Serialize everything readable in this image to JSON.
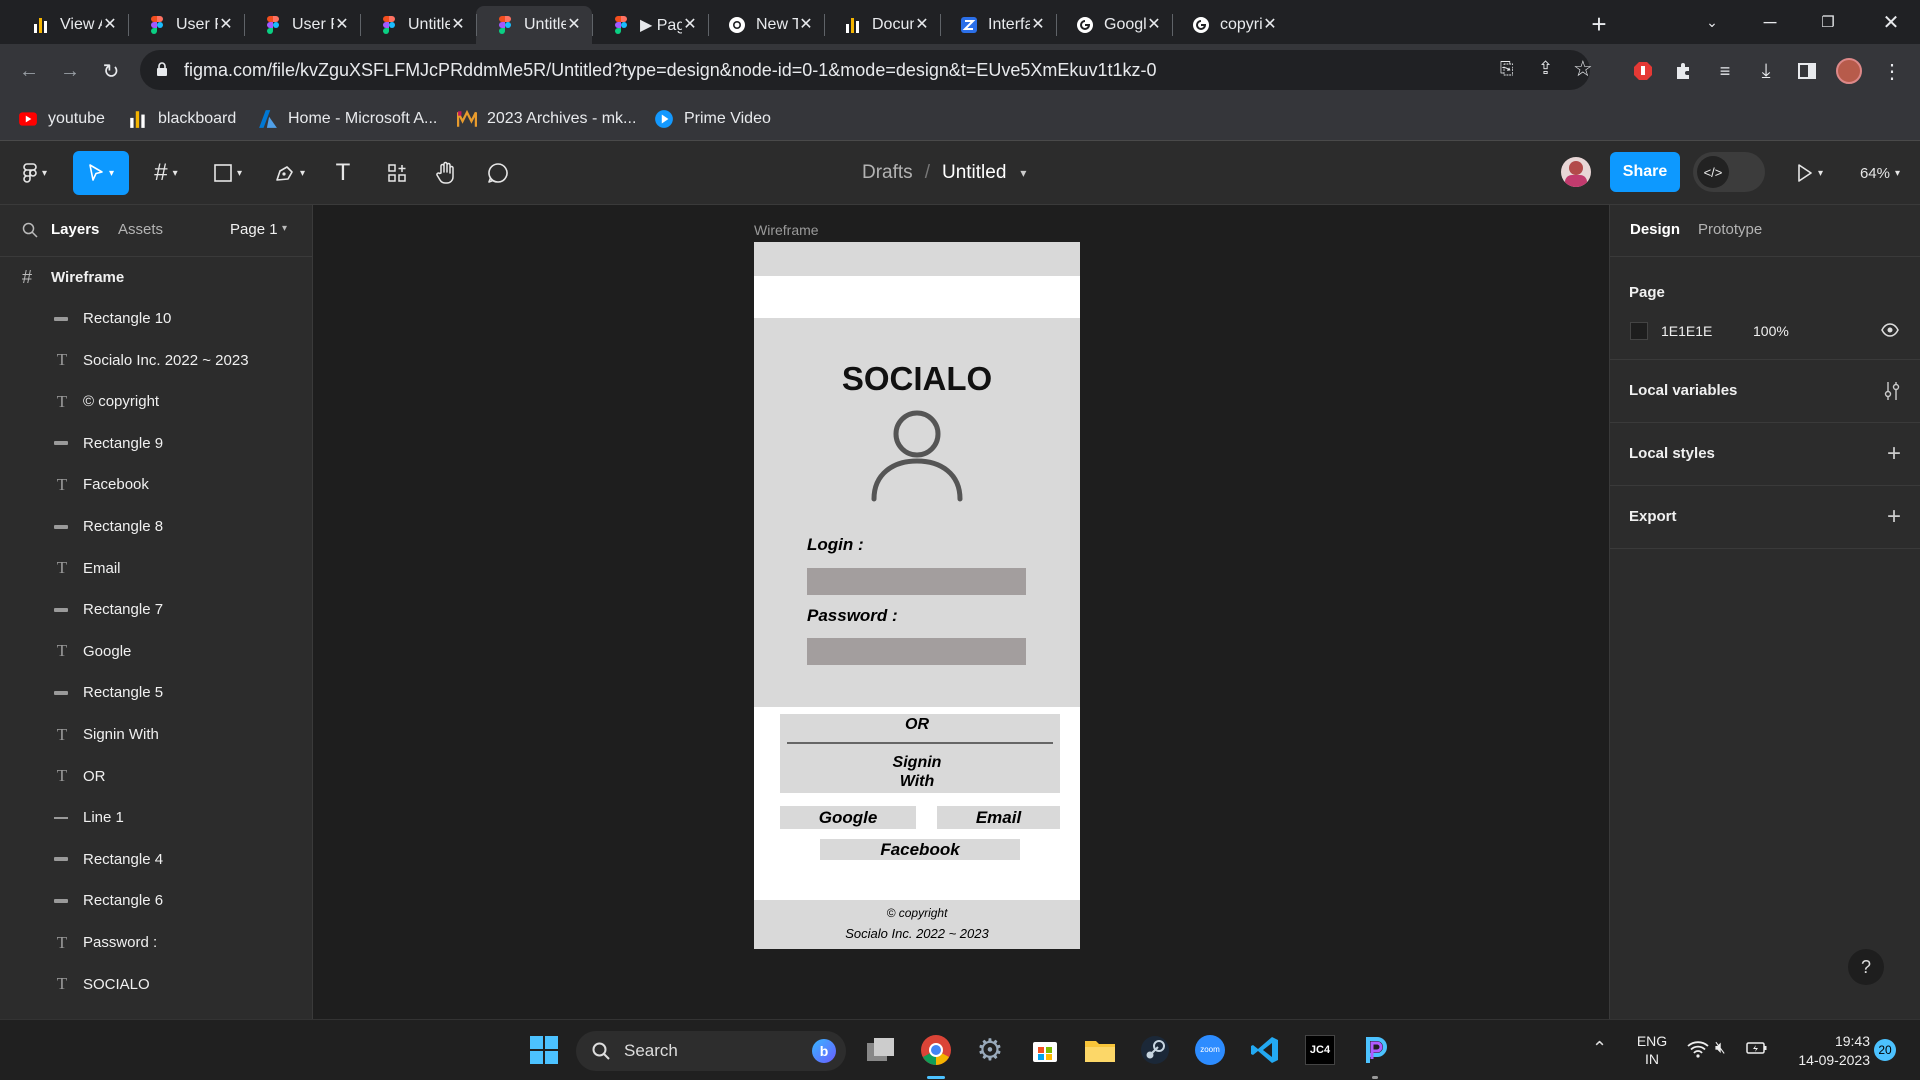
{
  "browser": {
    "tabs": [
      {
        "title": "View As",
        "favicon": "bar-chart-icon"
      },
      {
        "title": "User Pe",
        "favicon": "figma-icon"
      },
      {
        "title": "User Pe",
        "favicon": "figma-icon"
      },
      {
        "title": "Untitled",
        "favicon": "figma-icon"
      },
      {
        "title": "Untitled",
        "favicon": "figma-icon",
        "active": true
      },
      {
        "title": "▶ Page",
        "favicon": "figma-icon"
      },
      {
        "title": "New Tab",
        "favicon": "chrome-icon"
      },
      {
        "title": "Docume",
        "favicon": "bar-chart-icon"
      },
      {
        "title": "Interfac",
        "favicon": "z-icon"
      },
      {
        "title": "Google",
        "favicon": "google-icon"
      },
      {
        "title": "copyrig",
        "favicon": "google-icon"
      }
    ],
    "url": "figma.com/file/kvZguXSFLFMJcPRddmMe5R/Untitled?type=design&node-id=0-1&mode=design&t=EUve5XmEkuv1t1kz-0",
    "bookmarks": [
      {
        "label": "youtube",
        "icon": "youtube-icon"
      },
      {
        "label": "blackboard",
        "icon": "bar-chart-icon"
      },
      {
        "label": "Home - Microsoft A...",
        "icon": "azure-icon"
      },
      {
        "label": "2023 Archives - mk...",
        "icon": "m-logo-icon"
      },
      {
        "label": "Prime Video",
        "icon": "prime-video-icon"
      }
    ]
  },
  "figma": {
    "breadcrumb_parent": "Drafts",
    "breadcrumb_sep": "/",
    "file_name": "Untitled",
    "share_label": "Share",
    "zoom": "64%",
    "left_panel": {
      "tab_layers": "Layers",
      "tab_assets": "Assets",
      "page_selector": "Page 1",
      "frame_layer": "Wireframe",
      "layers": [
        {
          "name": "Rectangle 10",
          "icon": "rectangle-layer-icon"
        },
        {
          "name": "Socialo Inc. 2022 ~ 2023",
          "icon": "text-layer-icon"
        },
        {
          "name": "© copyright",
          "icon": "text-layer-icon"
        },
        {
          "name": "Rectangle 9",
          "icon": "rectangle-layer-icon"
        },
        {
          "name": "Facebook",
          "icon": "text-layer-icon"
        },
        {
          "name": "Rectangle 8",
          "icon": "rectangle-layer-icon"
        },
        {
          "name": "Email",
          "icon": "text-layer-icon"
        },
        {
          "name": "Rectangle 7",
          "icon": "rectangle-layer-icon"
        },
        {
          "name": "Google",
          "icon": "text-layer-icon"
        },
        {
          "name": "Rectangle 5",
          "icon": "rectangle-layer-icon"
        },
        {
          "name": "Signin With",
          "icon": "text-layer-icon"
        },
        {
          "name": "OR",
          "icon": "text-layer-icon"
        },
        {
          "name": "Line 1",
          "icon": "line-layer-icon"
        },
        {
          "name": "Rectangle 4",
          "icon": "rectangle-layer-icon"
        },
        {
          "name": "Rectangle 6",
          "icon": "rectangle-layer-icon"
        },
        {
          "name": "Password :",
          "icon": "text-layer-icon"
        },
        {
          "name": "SOCIALO",
          "icon": "text-layer-icon"
        }
      ]
    },
    "canvas": {
      "frame_label": "Wireframe",
      "app_title": "SOCIALO",
      "login_label": "Login :",
      "password_label": "Password :",
      "or_label": "OR",
      "signin_line1": "Signin",
      "signin_line2": "With",
      "google_label": "Google",
      "email_label": "Email",
      "facebook_label": "Facebook",
      "copyright": "© copyright",
      "company": "Socialo Inc. 2022 ~ 2023"
    },
    "right_panel": {
      "tab_design": "Design",
      "tab_prototype": "Prototype",
      "page_heading": "Page",
      "page_color": "1E1E1E",
      "page_opacity": "100%",
      "local_variables": "Local variables",
      "local_styles": "Local styles",
      "export": "Export",
      "help": "?"
    }
  },
  "taskbar": {
    "search_label": "Search",
    "lang_line1": "ENG",
    "lang_line2": "IN",
    "time": "19:43",
    "date": "14-09-2023",
    "notification_count": "20"
  }
}
